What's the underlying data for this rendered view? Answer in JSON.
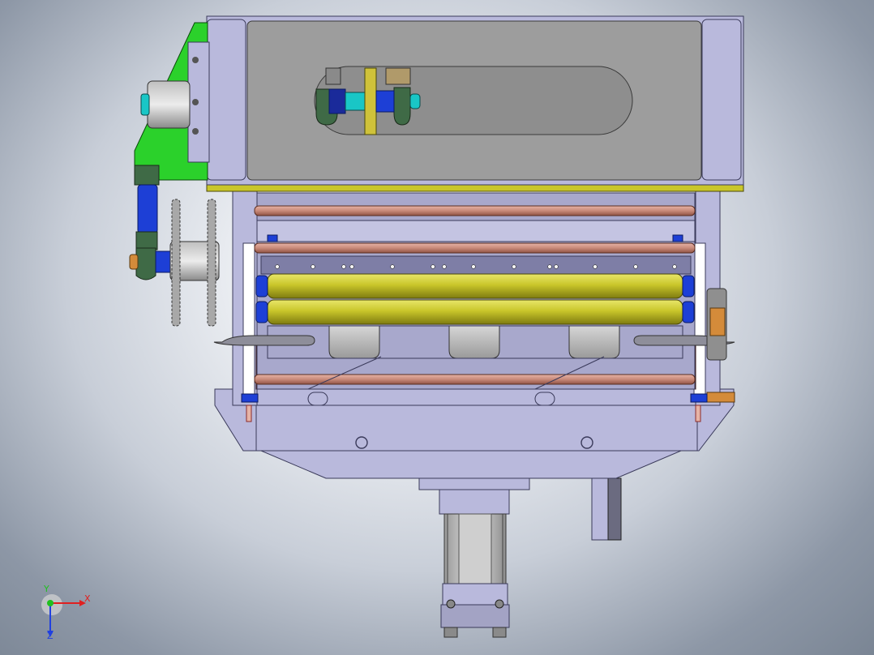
{
  "viewport": {
    "background_center": "#ffffff",
    "background_edge": "#7a8594"
  },
  "model": {
    "colors": {
      "frame": "#b9b9dc",
      "frame_dark": "#8e8eb4",
      "cover": "#9d9d9d",
      "bracket": "#2bd12b",
      "roller": "#c9c62a",
      "rod": "#c98a7a",
      "bearing_blue": "#1d3fd6",
      "cyan_shaft": "#19c6c6",
      "gear": "#cfc23a",
      "dark_red": "#8a2b2b",
      "orange_tab": "#d48b3a"
    }
  },
  "triad": {
    "x_label": "X",
    "y_label": "Y",
    "z_label": "Z",
    "x_color": "#e02020",
    "y_color": "#20c020",
    "z_color": "#2040e0"
  }
}
